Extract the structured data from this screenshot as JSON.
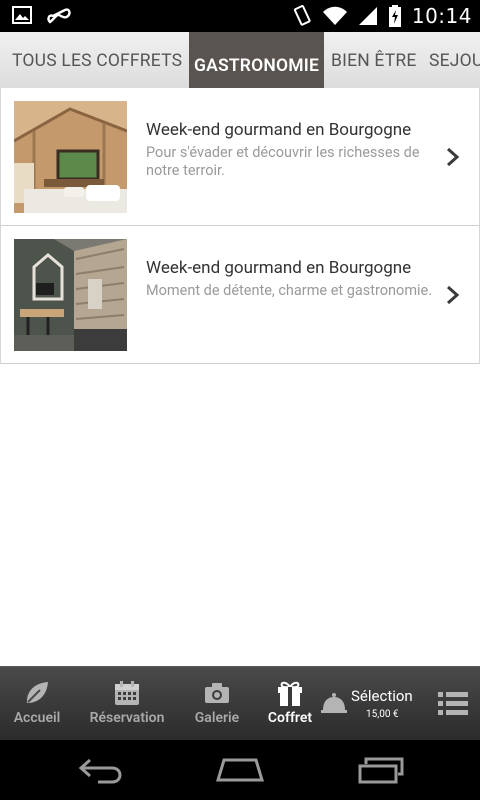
{
  "status_bar": {
    "time": "10:14",
    "icons": [
      "image-icon",
      "infinity-icon",
      "vibrate-icon",
      "wifi-icon",
      "signal-icon",
      "battery-icon"
    ]
  },
  "tabs": [
    {
      "label": "TOUS LES COFFRETS",
      "active": false
    },
    {
      "label": "GASTRONOMIE",
      "active": true
    },
    {
      "label": "BIEN ÊTRE",
      "active": false
    },
    {
      "label": "SEJOUR",
      "active": false
    }
  ],
  "items": [
    {
      "title": "Week-end gourmand en Bourgogne",
      "description": "Pour s'évader et découvrir les richesses de notre terroir."
    },
    {
      "title": "Week-end gourmand en Bourgogne",
      "description": "Moment de détente, charme et gastronomie."
    }
  ],
  "bottom_nav": {
    "items": [
      {
        "label": "Accueil",
        "icon": "leaf-icon",
        "active": false
      },
      {
        "label": "Réservation",
        "icon": "calendar-icon",
        "active": false
      },
      {
        "label": "Galerie",
        "icon": "camera-icon",
        "active": false
      },
      {
        "label": "Coffret",
        "icon": "gift-icon",
        "active": true
      }
    ],
    "selection": {
      "label": "Sélection",
      "price": "15,00 €",
      "icon": "cloche-icon"
    },
    "menu_icon": "list-menu-icon"
  },
  "colors": {
    "active_tab": "#5a5450",
    "bottom_nav": "#3a3a3a",
    "text_title": "#333333",
    "text_desc": "#9a9a9a"
  }
}
